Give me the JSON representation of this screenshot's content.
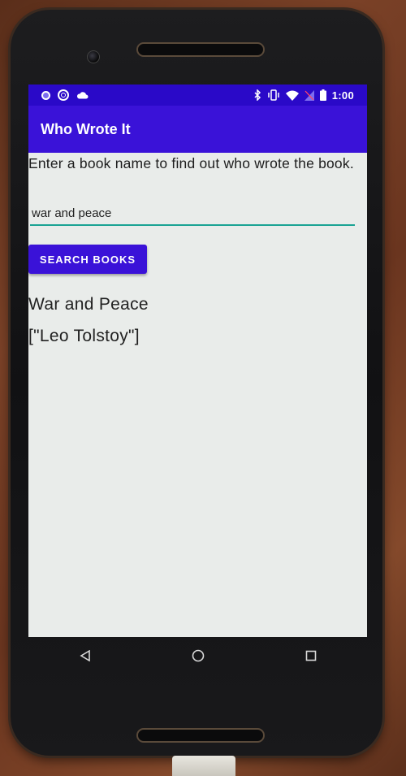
{
  "status_bar": {
    "time": "1:00",
    "left_icons": [
      "notification-dot-icon",
      "target-ring-icon",
      "cloud-icon"
    ],
    "right_icons": [
      "bluetooth-icon",
      "vibrate-icon",
      "wifi-icon",
      "signal-off-icon",
      "battery-icon"
    ]
  },
  "app_bar": {
    "title": "Who Wrote It",
    "color": "#3a12d8"
  },
  "main": {
    "instructions": "Enter a book name to find out who wrote the book.",
    "search_input": {
      "value": "war and peace",
      "placeholder": ""
    },
    "search_button_label": "SEARCH BOOKS",
    "result": {
      "title": "War and Peace",
      "authors": "[\"Leo Tolstoy\"]"
    }
  },
  "nav_bar": {
    "buttons": [
      "back-icon",
      "home-icon",
      "recents-icon"
    ]
  },
  "colors": {
    "accent": "#3a12d8",
    "status_bar": "#2a09c8",
    "input_underline": "#1aa394",
    "screen_bg": "#e9ecea"
  }
}
